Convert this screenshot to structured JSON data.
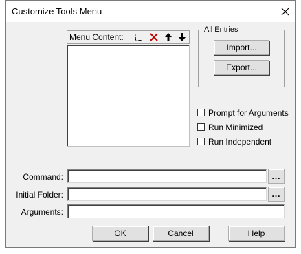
{
  "window": {
    "title": "Customize Tools Menu",
    "close_glyph": "✕"
  },
  "menu_content": {
    "label": "Menu Content:",
    "tools": [
      {
        "name": "new-item-icon",
        "glyph": "⬚"
      },
      {
        "name": "delete-icon",
        "glyph": "✕",
        "color": "#c00000"
      },
      {
        "name": "move-up-icon",
        "glyph": "↑"
      },
      {
        "name": "move-down-icon",
        "glyph": "↓"
      }
    ],
    "items": []
  },
  "all_entries": {
    "legend": "All Entries",
    "import_label": "Import...",
    "export_label": "Export..."
  },
  "options": {
    "prompt_for_arguments": {
      "label": "Prompt for  Arguments",
      "checked": false
    },
    "run_minimized": {
      "label": "Run Minimized",
      "checked": false
    },
    "run_independent": {
      "label": "Run Independent",
      "checked": false
    }
  },
  "fields": {
    "command": {
      "label": "Command:",
      "value": "",
      "browse": "..."
    },
    "initial_folder": {
      "label": "Initial Folder:",
      "value": "",
      "browse": "..."
    },
    "arguments": {
      "label": "Arguments:",
      "value": ""
    }
  },
  "buttons": {
    "ok": "OK",
    "cancel": "Cancel",
    "help": "Help"
  },
  "colors": {
    "dialog_bg": "#f0f0f0",
    "title_bg": "#ffffff",
    "delete_red": "#c00000"
  }
}
